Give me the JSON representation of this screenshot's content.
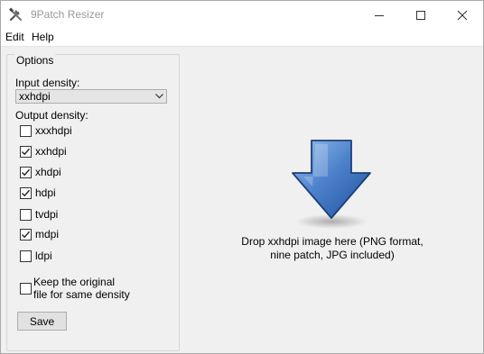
{
  "window": {
    "title": "9Patch Resizer",
    "minimize_icon": "minimize-icon",
    "maximize_icon": "maximize-icon",
    "close_icon": "close-icon"
  },
  "menu": [
    "Edit",
    "Help"
  ],
  "options": {
    "group_title": "Options",
    "input_density_label": "Input density:",
    "input_density_value": "xxhdpi",
    "output_density_label": "Output density:",
    "densities": [
      {
        "label": "xxxhdpi",
        "checked": false
      },
      {
        "label": "xxhdpi",
        "checked": true
      },
      {
        "label": "xhdpi",
        "checked": true
      },
      {
        "label": "hdpi",
        "checked": true
      },
      {
        "label": "tvdpi",
        "checked": false
      },
      {
        "label": "mdpi",
        "checked": true
      },
      {
        "label": "ldpi",
        "checked": false
      }
    ],
    "keep_original": {
      "line1": "Keep the original",
      "line2": "file for same density",
      "checked": false
    },
    "save_label": "Save"
  },
  "drop_zone": {
    "line1": "Drop xxhdpi image here (PNG format,",
    "line2": "nine patch, JPG included)",
    "icon": "down-arrow-icon",
    "accent_color": "#3a6fb8"
  }
}
